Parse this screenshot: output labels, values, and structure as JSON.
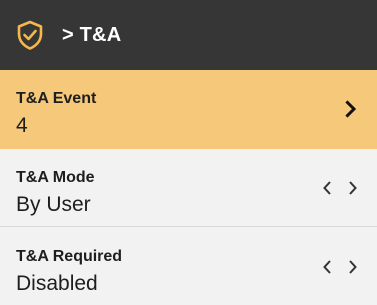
{
  "header": {
    "title": "> T&A",
    "icon": "shield-check-icon"
  },
  "items": [
    {
      "label": "T&A Event",
      "value": "4",
      "control": "chevron-right-icon",
      "selected": true
    },
    {
      "label": "T&A Mode",
      "value": "By User",
      "control": "left-right-arrows-icon",
      "selected": false
    },
    {
      "label": "T&A Required",
      "value": "Disabled",
      "control": "left-right-arrows-icon",
      "selected": false
    }
  ],
  "colors": {
    "header_bg": "#363636",
    "selected_bg": "#f5c87a",
    "row_bg": "#f2f2f2",
    "text": "#1e1e1e"
  }
}
